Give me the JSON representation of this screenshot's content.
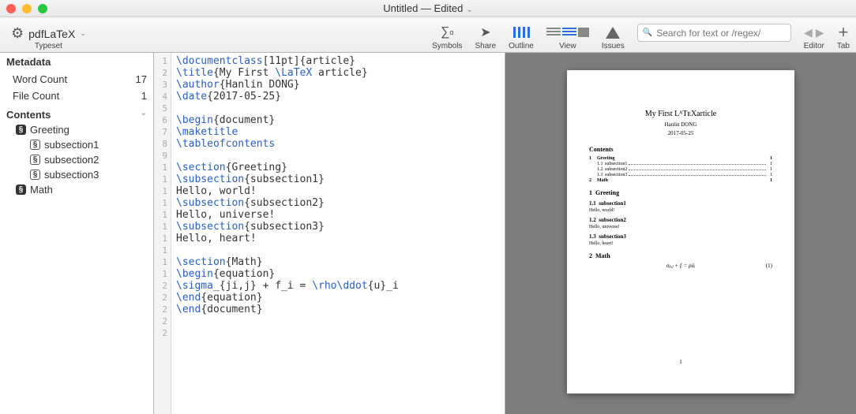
{
  "titlebar": {
    "title": "Untitled — Edited"
  },
  "toolbar": {
    "typeset_label": "Typeset",
    "engine": "pdfLaTeX",
    "items": {
      "symbols": "Symbols",
      "share": "Share",
      "outline": "Outline",
      "view": "View",
      "issues": "Issues",
      "editor": "Editor",
      "tab": "Tab"
    },
    "search_placeholder": "Search for text or /regex/"
  },
  "sidebar": {
    "metadata_title": "Metadata",
    "word_count_label": "Word Count",
    "word_count": "17",
    "file_count_label": "File Count",
    "file_count": "1",
    "contents_title": "Contents",
    "tree": [
      {
        "label": "Greeting",
        "sub": false
      },
      {
        "label": "subsection1",
        "sub": true
      },
      {
        "label": "subsection2",
        "sub": true
      },
      {
        "label": "subsection3",
        "sub": true
      },
      {
        "label": "Math",
        "sub": false
      }
    ]
  },
  "editor": {
    "gutter": [
      "1",
      "2",
      "3",
      "4",
      "5",
      "6",
      "7",
      "8",
      "9",
      "1",
      "1",
      "1",
      "1",
      "1",
      "1",
      "1",
      "1",
      "1",
      "1",
      "2",
      "2",
      "2",
      "2",
      "2"
    ],
    "lines": [
      [
        [
          "kw",
          "\\documentclass"
        ],
        [
          "",
          "[11pt]{article}"
        ]
      ],
      [
        [
          "kw",
          "\\title"
        ],
        [
          "",
          "{My First "
        ],
        [
          "kw",
          "\\LaTeX"
        ],
        [
          "",
          " article}"
        ]
      ],
      [
        [
          "kw",
          "\\author"
        ],
        [
          "",
          "{Hanlin DONG}"
        ]
      ],
      [
        [
          "kw",
          "\\date"
        ],
        [
          "",
          "{2017-05-25}"
        ]
      ],
      [
        [
          "",
          ""
        ]
      ],
      [
        [
          "kw",
          "\\begin"
        ],
        [
          "",
          "{document}"
        ]
      ],
      [
        [
          "kw",
          "\\maketitle"
        ]
      ],
      [
        [
          "kw",
          "\\tableofcontents"
        ]
      ],
      [
        [
          "",
          ""
        ]
      ],
      [
        [
          "kw",
          "\\section"
        ],
        [
          "",
          "{Greeting}"
        ]
      ],
      [
        [
          "kw",
          "\\subsection"
        ],
        [
          "",
          "{subsection1}"
        ]
      ],
      [
        [
          "",
          "Hello, world!"
        ]
      ],
      [
        [
          "kw",
          "\\subsection"
        ],
        [
          "",
          "{subsection2}"
        ]
      ],
      [
        [
          "",
          "Hello, universe!"
        ]
      ],
      [
        [
          "kw",
          "\\subsection"
        ],
        [
          "",
          "{subsection3}"
        ]
      ],
      [
        [
          "",
          "Hello, heart!"
        ]
      ],
      [
        [
          "",
          ""
        ]
      ],
      [
        [
          "kw",
          "\\section"
        ],
        [
          "",
          "{Math}"
        ]
      ],
      [
        [
          "kw",
          "\\begin"
        ],
        [
          "",
          "{equation}"
        ]
      ],
      [
        [
          "kw",
          "\\sigma"
        ],
        [
          "",
          "_{ji,j} + f_i = "
        ],
        [
          "kw",
          "\\rho\\ddot"
        ],
        [
          "",
          "{u}_i"
        ]
      ],
      [
        [
          "kw",
          "\\end"
        ],
        [
          "",
          "{equation}"
        ]
      ],
      [
        [
          "kw",
          "\\end"
        ],
        [
          "",
          "{document}"
        ]
      ],
      [
        [
          "",
          ""
        ]
      ],
      [
        [
          "",
          ""
        ]
      ]
    ]
  },
  "preview": {
    "title": "My First LᴬTᴇXarticle",
    "author": "Hanlin DONG",
    "date": "2017-05-25",
    "contents_heading": "Contents",
    "toc": [
      {
        "n": "1",
        "t": "Greeting",
        "p": "1",
        "sub": false,
        "dots": false
      },
      {
        "n": "1.1",
        "t": "subsection1",
        "p": "1",
        "sub": true,
        "dots": true
      },
      {
        "n": "1.2",
        "t": "subsection2",
        "p": "1",
        "sub": true,
        "dots": true
      },
      {
        "n": "1.3",
        "t": "subsection3",
        "p": "1",
        "sub": true,
        "dots": true
      },
      {
        "n": "2",
        "t": "Math",
        "p": "1",
        "sub": false,
        "dots": false
      }
    ],
    "sect1": {
      "n": "1",
      "t": "Greeting"
    },
    "ss1": {
      "n": "1.1",
      "t": "subsection1",
      "body": "Hello, world!"
    },
    "ss2": {
      "n": "1.2",
      "t": "subsection2",
      "body": "Hello, universe!"
    },
    "ss3": {
      "n": "1.3",
      "t": "subsection3",
      "body": "Hello, heart!"
    },
    "sect2": {
      "n": "2",
      "t": "Math"
    },
    "equation": "σⱼᵢ,ⱼ + fᵢ = ρüᵢ",
    "eqnum": "(1)",
    "pagenum": "1"
  }
}
